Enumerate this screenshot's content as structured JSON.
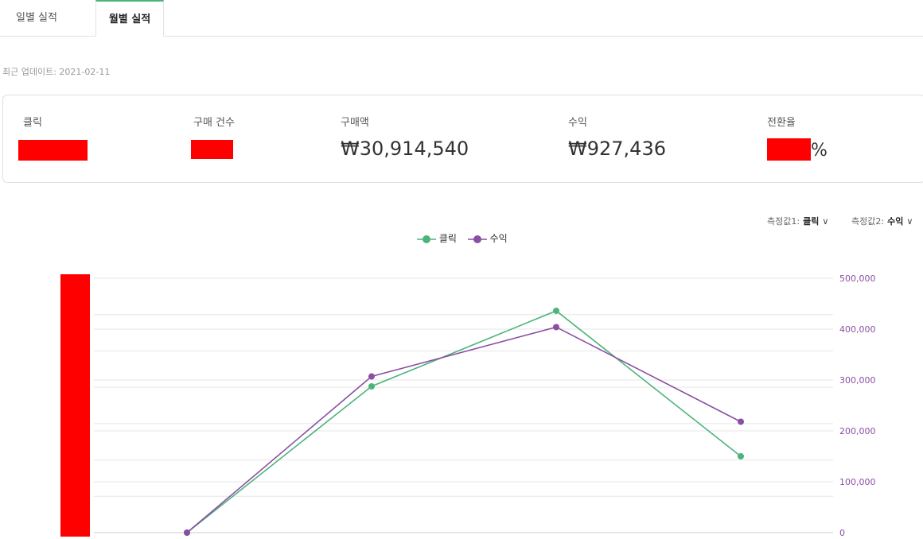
{
  "tabs": [
    {
      "label": "일별 실적"
    },
    {
      "label": "월별 실적"
    }
  ],
  "updated": "최근 업데이트: 2021-02-11",
  "summary": {
    "clicks_label": "클릭",
    "purchases_label": "구매 건수",
    "amount_label": "구매액",
    "amount_value": "₩30,914,540",
    "revenue_label": "수익",
    "revenue_value": "₩927,436",
    "conversion_label": "전환율",
    "conversion_suffix": "%"
  },
  "measure1": {
    "label": "측정값1:",
    "value": "클릭"
  },
  "measure2": {
    "label": "측정값2:",
    "value": "수익"
  },
  "colors": {
    "clicks": "#4cb47b",
    "revenue": "#8a4fa3",
    "redaction": "#ff0000",
    "accent": "#4cb47b"
  },
  "chart_data": {
    "type": "line",
    "x": [
      0,
      1,
      2,
      3
    ],
    "series": [
      {
        "name": "클릭",
        "color": "#4cb47b",
        "axis": "left-redacted",
        "values": [
          0,
          287500,
          436000,
          150000
        ]
      },
      {
        "name": "수익",
        "color": "#8a4fa3",
        "axis": "right",
        "values": [
          0,
          307000,
          404000,
          218000
        ]
      }
    ],
    "y2_ticks": [
      "500,000",
      "400,000",
      "300,000",
      "200,000",
      "100,000",
      "0"
    ],
    "ylim": [
      0,
      500000
    ],
    "grid": true,
    "legend": "top-center"
  }
}
